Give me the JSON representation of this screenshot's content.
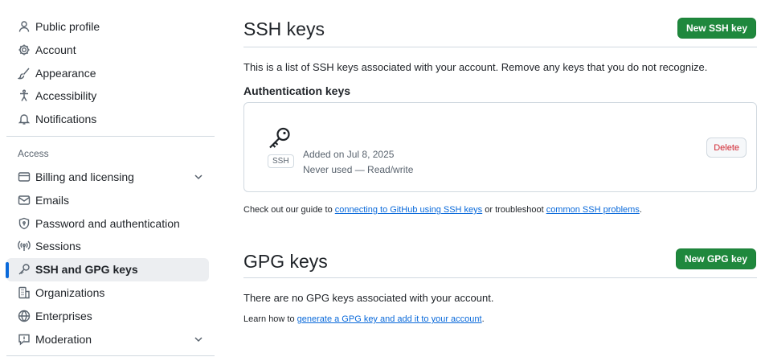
{
  "sidebar": {
    "items": [
      {
        "label": "Public profile",
        "icon": "person-icon"
      },
      {
        "label": "Account",
        "icon": "gear-icon"
      },
      {
        "label": "Appearance",
        "icon": "paintbrush-icon"
      },
      {
        "label": "Accessibility",
        "icon": "accessibility-icon"
      },
      {
        "label": "Notifications",
        "icon": "bell-icon"
      }
    ],
    "access_title": "Access",
    "access_items": [
      {
        "label": "Billing and licensing",
        "icon": "credit-card-icon",
        "expandable": true
      },
      {
        "label": "Emails",
        "icon": "mail-icon"
      },
      {
        "label": "Password and authentication",
        "icon": "shield-lock-icon"
      },
      {
        "label": "Sessions",
        "icon": "broadcast-icon"
      },
      {
        "label": "SSH and GPG keys",
        "icon": "key-icon",
        "active": true
      },
      {
        "label": "Organizations",
        "icon": "organization-icon"
      },
      {
        "label": "Enterprises",
        "icon": "globe-icon"
      },
      {
        "label": "Moderation",
        "icon": "report-icon",
        "expandable": true
      }
    ]
  },
  "ssh": {
    "title": "SSH keys",
    "new_button": "New SSH key",
    "description": "This is a list of SSH keys associated with your account. Remove any keys that you do not recognize.",
    "auth_heading": "Authentication keys",
    "key": {
      "badge": "SSH",
      "added": "Added on Jul 8, 2025",
      "usage": "Never used — Read/write",
      "delete_label": "Delete"
    },
    "guide": {
      "prefix": "Check out our guide to ",
      "link1": "connecting to GitHub using SSH keys",
      "middle": " or troubleshoot ",
      "link2": "common SSH problems",
      "suffix": "."
    }
  },
  "gpg": {
    "title": "GPG keys",
    "new_button": "New GPG key",
    "empty_text": "There are no GPG keys associated with your account.",
    "learn": {
      "prefix": "Learn how to ",
      "link": "generate a GPG key and add it to your account",
      "suffix": "."
    }
  },
  "colors": {
    "accent": "#0969da",
    "primary_button": "#1f883d",
    "danger": "#d1242f",
    "muted": "#59636e",
    "border": "#d1d9e0"
  }
}
